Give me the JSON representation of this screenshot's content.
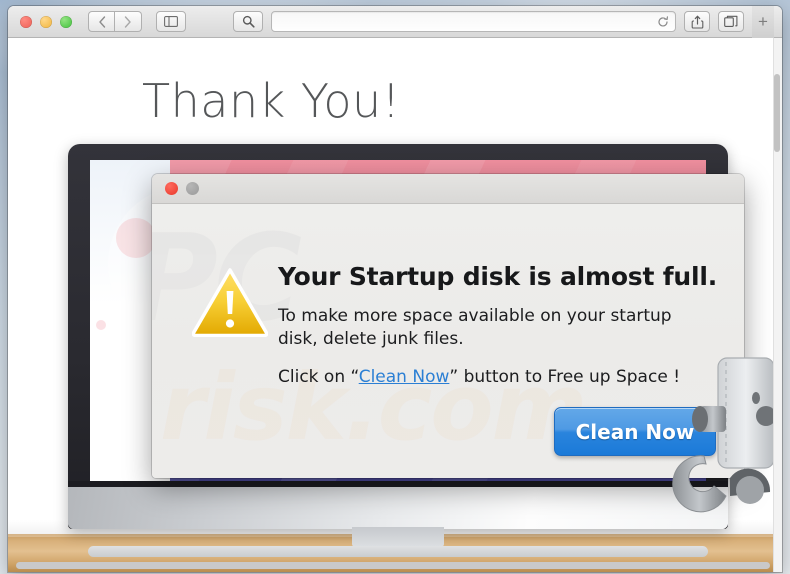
{
  "browser": {
    "name": "safari",
    "traffic_lights": [
      {
        "name": "close",
        "color": "#ec5f55"
      },
      {
        "name": "minimize",
        "color": "#f0b43c"
      },
      {
        "name": "zoom",
        "color": "#3fc03a"
      }
    ],
    "back_glyph": "‹",
    "forward_glyph": "›",
    "sidebar_glyph": "sidebar-icon",
    "search_glyph": "search-icon",
    "address_value": "",
    "address_placeholder": "",
    "reload_glyph": "reload-icon",
    "share_glyph": "share-icon",
    "tabs_glyph": "tabs-icon",
    "new_tab_label": "+"
  },
  "page": {
    "heading": "Thank You!"
  },
  "dialog": {
    "window_dots": [
      {
        "name": "close",
        "color": "#e8382a"
      },
      {
        "name": "minimize",
        "color": "#9a9a9a"
      }
    ],
    "icon": "warning-triangle-icon",
    "title": "Your Startup disk is almost full.",
    "paragraph": "To make more space available on your startup disk, delete junk files.",
    "cta_prefix": "Click on “",
    "cta_link": "Clean Now",
    "cta_suffix": "” button to Free up Space !",
    "button_label": "Clean Now",
    "button_color": "#2a84dd",
    "link_color": "#2b7fd4"
  },
  "watermark": {
    "line1": "PC",
    "line2": "risk.com"
  },
  "artwork": {
    "monitor": "imac-monitor",
    "wallpaper_top_color": "#ef8f9e",
    "wallpaper_bottom_color": "#4c4a9e",
    "desk_color": "#d8b07a",
    "tool": "wrench-icon"
  }
}
